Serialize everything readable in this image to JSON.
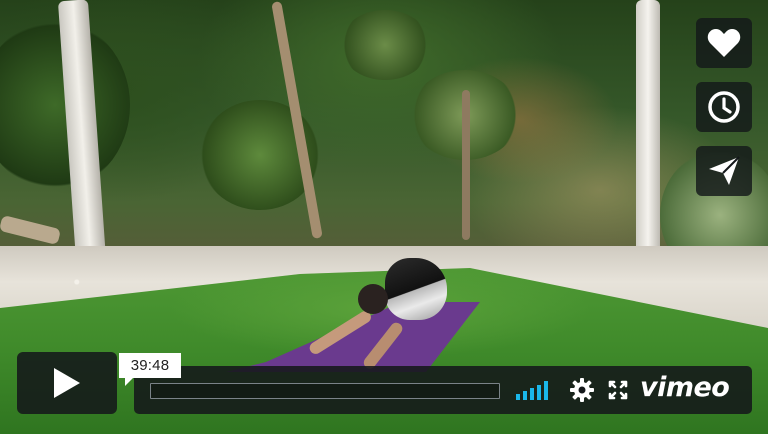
{
  "player": {
    "timecode": "39:48",
    "brand": "vimeo",
    "progress": 0,
    "volume_bars": 5
  },
  "side_actions": [
    {
      "name": "like",
      "icon": "heart-icon"
    },
    {
      "name": "watch-later",
      "icon": "clock-icon"
    },
    {
      "name": "share",
      "icon": "paper-plane-icon"
    }
  ],
  "controls": {
    "play_icon": "play-icon",
    "volume_icon": "volume-bars-icon",
    "settings_icon": "gear-icon",
    "fullscreen_icon": "fullscreen-icon"
  },
  "colors": {
    "accent": "#1ab7ea",
    "panel": "#14181a",
    "mat": "#6a3a8e"
  }
}
